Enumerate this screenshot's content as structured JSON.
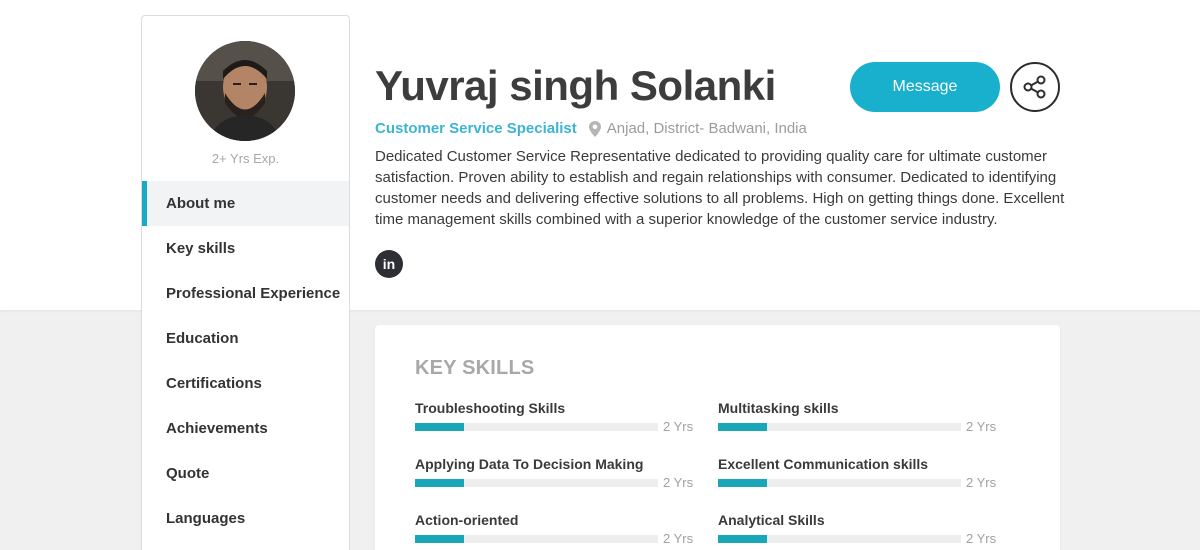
{
  "profile": {
    "name": "Yuvraj singh Solanki",
    "job_title": "Customer Service Specialist",
    "location": "Anjad, District- Badwani, India",
    "experience": "2+ Yrs Exp.",
    "bio": "Dedicated Customer Service Representative dedicated to providing quality care for ultimate customer satisfaction. Proven ability to establish and regain relationships with consumer. Dedicated to identifying customer needs and delivering effective solutions to all problems. High on getting things done. Excellent time management skills combined with a superior knowledge of the customer service industry.",
    "linkedin_label": "in"
  },
  "actions": {
    "message_label": "Message"
  },
  "nav": {
    "items": [
      {
        "label": "About me",
        "active": true
      },
      {
        "label": "Key skills",
        "active": false
      },
      {
        "label": "Professional Experience",
        "active": false
      },
      {
        "label": "Education",
        "active": false
      },
      {
        "label": "Certifications",
        "active": false
      },
      {
        "label": "Achievements",
        "active": false
      },
      {
        "label": "Quote",
        "active": false
      },
      {
        "label": "Languages",
        "active": false
      }
    ]
  },
  "skills": {
    "title": "KEY SKILLS",
    "items": [
      {
        "name": "Troubleshooting Skills",
        "years": "2 Yrs",
        "level": 0.2
      },
      {
        "name": "Multitasking skills",
        "years": "2 Yrs",
        "level": 0.2
      },
      {
        "name": "Applying Data To Decision Making",
        "years": "2 Yrs",
        "level": 0.2
      },
      {
        "name": "Excellent Communication skills",
        "years": "2 Yrs",
        "level": 0.2
      },
      {
        "name": "Action-oriented",
        "years": "2 Yrs",
        "level": 0.2
      },
      {
        "name": "Analytical Skills",
        "years": "2 Yrs",
        "level": 0.2
      }
    ]
  },
  "colors": {
    "accent": "#18b0cc",
    "skill_bar": "#18a6b8",
    "job_title": "#3cb4d2",
    "linkedin": "#2d2f35"
  },
  "icons": {
    "location": "map-pin-icon",
    "share": "share-icon",
    "linkedin": "linkedin-icon"
  }
}
